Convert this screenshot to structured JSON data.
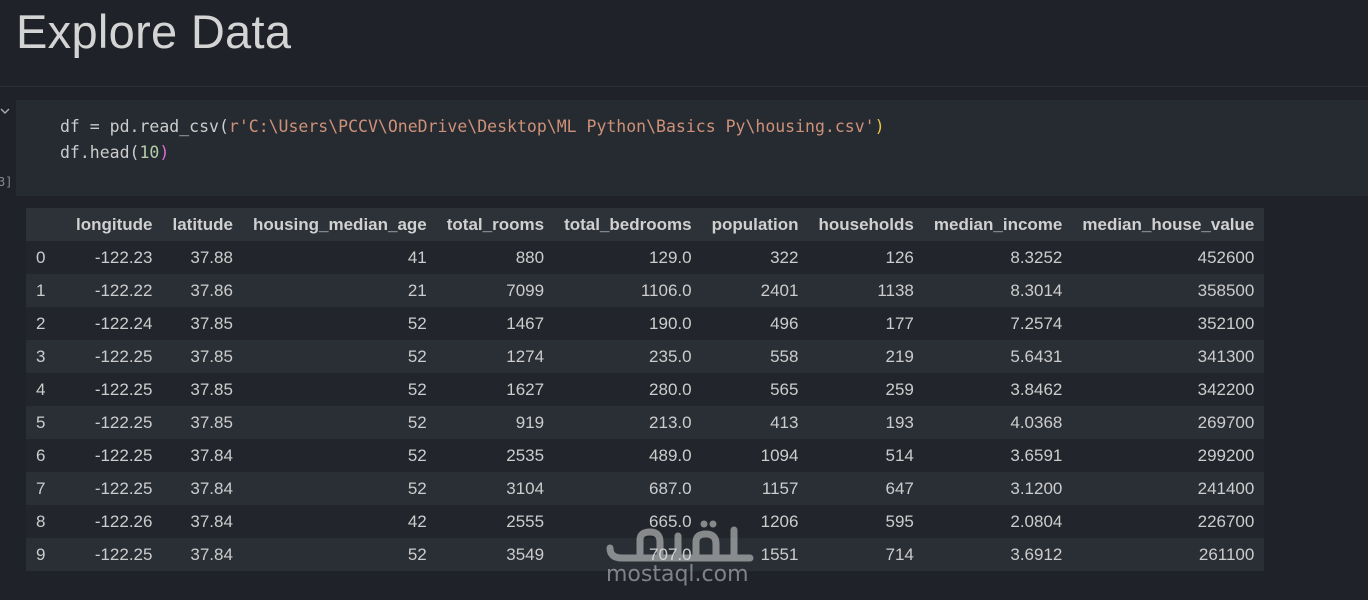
{
  "heading": "Explore Data",
  "cell": {
    "execution_count": "3]",
    "code_line1": {
      "pre": "df = pd.read_csv(",
      "str": "r'C:\\Users\\PCCV\\OneDrive\\Desktop\\ML Python\\Basics Py\\housing.csv'",
      "post": ")"
    },
    "code_line2": {
      "pre": "df.head(",
      "num": "10",
      "post": ")"
    }
  },
  "table": {
    "columns": [
      "",
      "longitude",
      "latitude",
      "housing_median_age",
      "total_rooms",
      "total_bedrooms",
      "population",
      "households",
      "median_income",
      "median_house_value"
    ],
    "rows": [
      [
        "0",
        "-122.23",
        "37.88",
        "41",
        "880",
        "129.0",
        "322",
        "126",
        "8.3252",
        "452600"
      ],
      [
        "1",
        "-122.22",
        "37.86",
        "21",
        "7099",
        "1106.0",
        "2401",
        "1138",
        "8.3014",
        "358500"
      ],
      [
        "2",
        "-122.24",
        "37.85",
        "52",
        "1467",
        "190.0",
        "496",
        "177",
        "7.2574",
        "352100"
      ],
      [
        "3",
        "-122.25",
        "37.85",
        "52",
        "1274",
        "235.0",
        "558",
        "219",
        "5.6431",
        "341300"
      ],
      [
        "4",
        "-122.25",
        "37.85",
        "52",
        "1627",
        "280.0",
        "565",
        "259",
        "3.8462",
        "342200"
      ],
      [
        "5",
        "-122.25",
        "37.85",
        "52",
        "919",
        "213.0",
        "413",
        "193",
        "4.0368",
        "269700"
      ],
      [
        "6",
        "-122.25",
        "37.84",
        "52",
        "2535",
        "489.0",
        "1094",
        "514",
        "3.6591",
        "299200"
      ],
      [
        "7",
        "-122.25",
        "37.84",
        "52",
        "3104",
        "687.0",
        "1157",
        "647",
        "3.1200",
        "241400"
      ],
      [
        "8",
        "-122.26",
        "37.84",
        "42",
        "2555",
        "665.0",
        "1206",
        "595",
        "2.0804",
        "226700"
      ],
      [
        "9",
        "-122.25",
        "37.84",
        "52",
        "3549",
        "707.0",
        "1551",
        "714",
        "3.6912",
        "261100"
      ]
    ]
  },
  "watermark": {
    "logo_text": "مستقل",
    "site": "mostaql.com"
  }
}
